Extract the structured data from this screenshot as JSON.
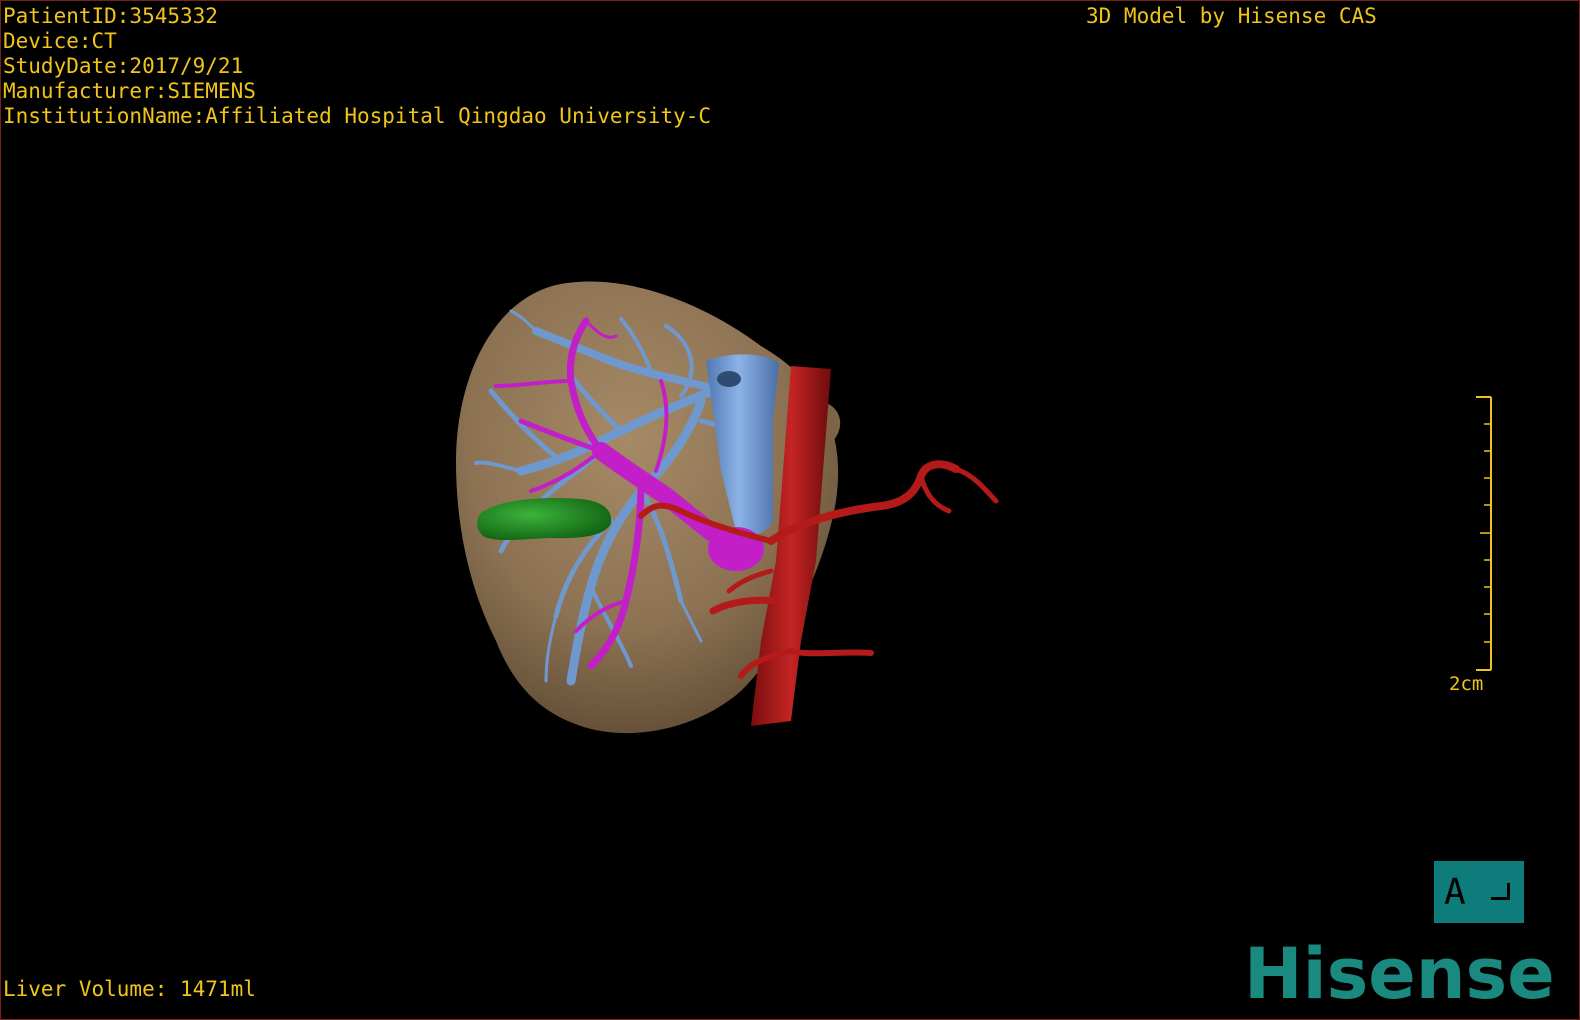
{
  "patient_info": {
    "patient_id": "PatientID:3545332",
    "device": "Device:CT",
    "study_date": "StudyDate:2017/9/21",
    "manufacturer": "Manufacturer:SIEMENS",
    "institution": "InstitutionName:Affiliated Hospital Qingdao University-C"
  },
  "credit": "3D Model by Hisense CAS",
  "liver_volume": "Liver Volume: 1471ml",
  "scale": {
    "label": "2cm"
  },
  "orientation": {
    "label": "A"
  },
  "logo": {
    "text": "Hisense",
    "color": "#1a8a80"
  },
  "colors": {
    "overlay_text": "#f0c419",
    "liver": "#8c7253",
    "hepatic_vein": "#6f98cf",
    "portal_vein": "#c21fc8",
    "artery": "#b51a1a",
    "gallbladder": "#1f8a1f",
    "orientation_cube": "#0f7c7c"
  },
  "model_parts": [
    "liver",
    "hepatic-vein",
    "portal-vein",
    "artery",
    "gallbladder"
  ]
}
